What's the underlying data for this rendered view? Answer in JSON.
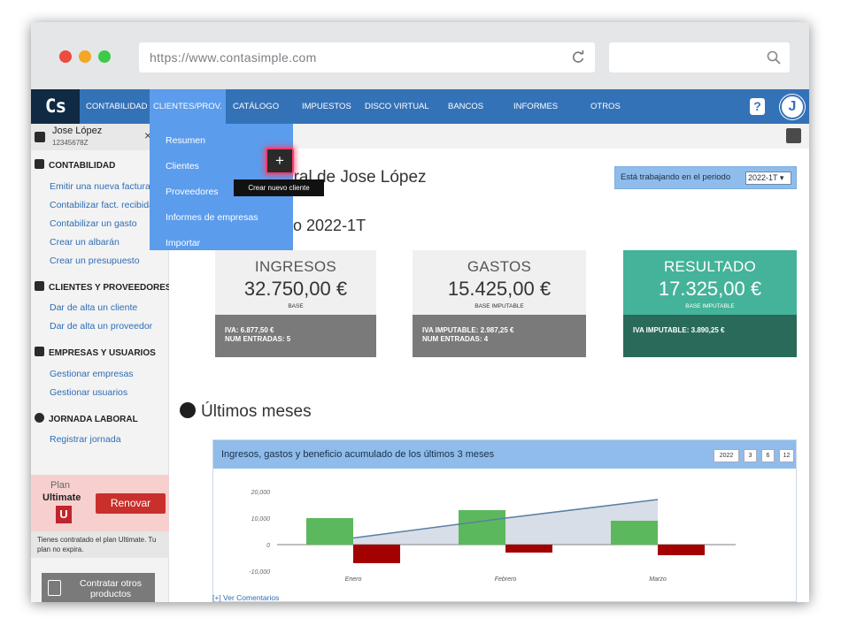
{
  "browser": {
    "url": "https://www.contasimple.com",
    "dot_colors": [
      "#ee4b3e",
      "#f5a623",
      "#3ec949"
    ]
  },
  "nav": {
    "logo": "Cs",
    "items": [
      "CONTABILIDAD",
      "CLIENTES/PROV.",
      "CATÁLOGO",
      "IMPUESTOS",
      "DISCO VIRTUAL",
      "BANCOS",
      "INFORMES",
      "OTROS"
    ],
    "active_index": 1,
    "help": "?",
    "avatar": "J"
  },
  "sidebar": {
    "user": {
      "name": "Jose López",
      "nif": "12345678Z",
      "close": "×"
    },
    "sections": [
      {
        "title": "CONTABILIDAD",
        "links": [
          "Emitir una nueva factura",
          "Contabilizar fact. recibida",
          "Contabilizar un gasto",
          "Crear un albarán",
          "Crear un presupuesto"
        ]
      },
      {
        "title": "CLIENTES Y PROVEEDORES",
        "links": [
          "Dar de alta un cliente",
          "Dar de alta un proveedor"
        ]
      },
      {
        "title": "EMPRESAS Y USUARIOS",
        "links": [
          "Gestionar empresas",
          "Gestionar usuarios"
        ]
      },
      {
        "title": "JORNADA LABORAL",
        "links": [
          "Registrar jornada"
        ]
      }
    ],
    "plan": {
      "label": "Plan",
      "name": "Ultimate",
      "badge": "U",
      "renew": "Renovar",
      "note": "Tienes contratado el plan Ultimate. Tu plan no expira."
    },
    "contract": "Contratar otros productos"
  },
  "dropdown": {
    "items": [
      "Resumen",
      "Clientes",
      "Proveedores",
      "Informes de empresas",
      "Importar"
    ],
    "add_button": "+",
    "tooltip": "Crear nuevo cliente"
  },
  "main": {
    "title": "eral de Jose López",
    "period_label": "Está trabajando en el periodo",
    "period_value": "2022-1T",
    "period_heading": "do 2022-1T",
    "cards": [
      {
        "title": "INGRESOS",
        "value": "32.750,00 €",
        "sub": "BASE",
        "line1_label": "IVA:",
        "line1_value": "6.877,50 €",
        "line2_label": "NUM ENTRADAS:",
        "line2_value": "5"
      },
      {
        "title": "GASTOS",
        "value": "15.425,00 €",
        "sub": "BASE IMPUTABLE",
        "line1_label": "IVA IMPUTABLE:",
        "line1_value": "2.987,25 €",
        "line2_label": "NUM ENTRADAS:",
        "line2_value": "4"
      },
      {
        "title": "RESULTADO",
        "value": "17.325,00 €",
        "sub": "BASE IMPUTABLE",
        "line1_label": "IVA IMPUTABLE:",
        "line1_value": "3.890,25 €",
        "line2_label": "",
        "line2_value": ""
      }
    ],
    "section_heading": "Últimos meses",
    "chart_title": "Ingresos, gastos y beneficio acumulado de los últimos 3 meses",
    "range_buttons": [
      "2022",
      "3",
      "6",
      "12"
    ],
    "comments_link": "[+] Ver Comentarios"
  },
  "colors": {
    "nav": "#3472b7",
    "nav_active": "#5b9cec",
    "card_green": "#44b39a",
    "card_green_dark": "#2a6a5a",
    "ingresos_bar": "#5cb85c",
    "gastos_bar": "#a30000",
    "line": "#5a7fa5"
  },
  "chart_data": {
    "type": "bar",
    "categories": [
      "Enero",
      "Febrero",
      "Marzo"
    ],
    "series": [
      {
        "values": [
          10000,
          13000,
          9000
        ],
        "kind": "bar",
        "color": "#5cb85c"
      },
      {
        "values": [
          -7000,
          -3000,
          -4000
        ],
        "kind": "bar",
        "color": "#a30000"
      },
      {
        "values": [
          2500,
          10000,
          17000
        ],
        "kind": "area-line",
        "color": "#5a7fa5"
      }
    ],
    "y_ticks": [
      "20,000",
      "10,000",
      "0",
      "-10,000"
    ],
    "ylim": [
      -10000,
      20000
    ],
    "grid": false
  }
}
